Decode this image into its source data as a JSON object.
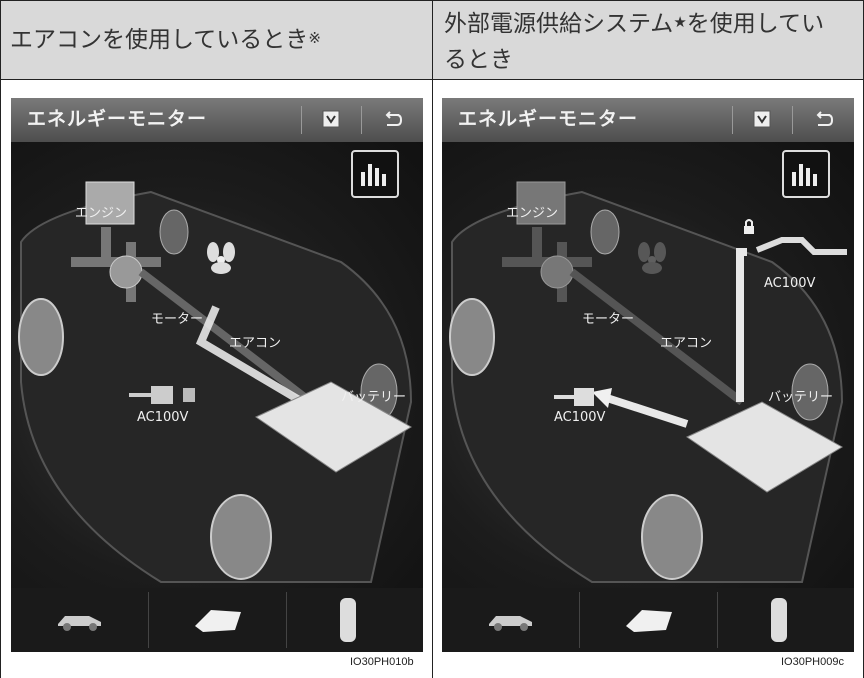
{
  "headers": {
    "left": {
      "text": "エアコンを使用しているとき",
      "mark": "※"
    },
    "right": {
      "line1": "外部電源供給システム",
      "star": "★",
      "line1b": "を使用してい",
      "line2": "るとき"
    }
  },
  "panels": [
    {
      "title": "エネルギーモニター",
      "labels": {
        "engine": "エンジン",
        "motor": "モーター",
        "aircon": "エアコン",
        "battery": "バッテリー",
        "ac": "AC100V"
      },
      "code": "IO30PH010b"
    },
    {
      "title": "エネルギーモニター",
      "labels": {
        "engine": "エンジン",
        "motor": "モーター",
        "aircon": "エアコン",
        "battery": "バッテリー",
        "ac_out": "AC100V",
        "ac_in": "AC100V"
      },
      "code": "IO30PH009c"
    }
  ],
  "icons": [
    "graph-icon",
    "back-icon",
    "car-side-icon",
    "car-angle-icon",
    "car-top-icon",
    "plug-icon",
    "fan-icon",
    "lock-icon"
  ]
}
